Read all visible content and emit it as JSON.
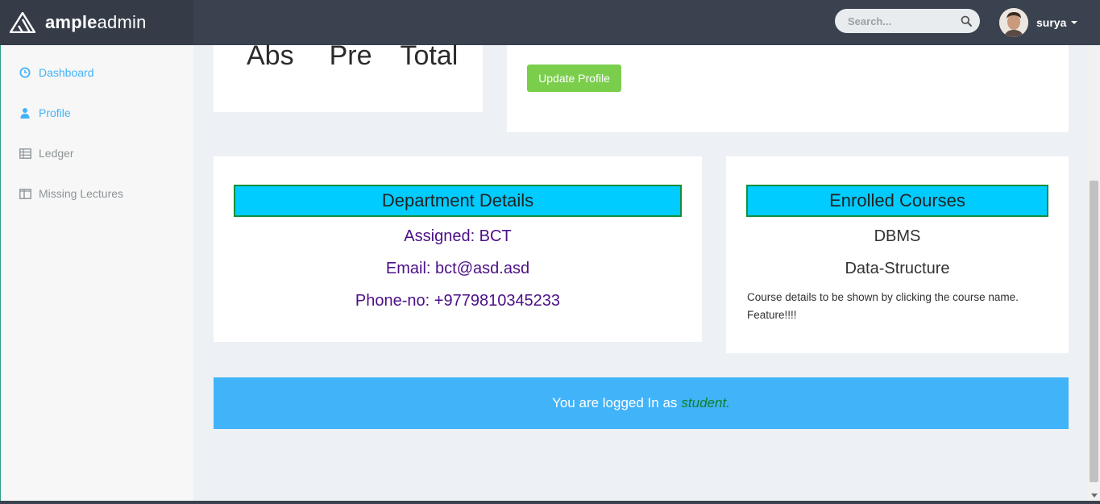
{
  "brand": {
    "bold": "ample",
    "light": "admin"
  },
  "header": {
    "search_placeholder": "Search...",
    "user_name": "surya"
  },
  "sidebar": {
    "items": [
      {
        "label": "Dashboard",
        "icon": "clock-icon",
        "active": true
      },
      {
        "label": "Profile",
        "icon": "user-icon",
        "active": true
      },
      {
        "label": "Ledger",
        "icon": "table-icon",
        "active": false
      },
      {
        "label": "Missing Lectures",
        "icon": "columns-icon",
        "active": false
      }
    ]
  },
  "attendance": {
    "labels": [
      "Abs",
      "Pre",
      "Total"
    ]
  },
  "profile": {
    "update_button": "Update Profile"
  },
  "department": {
    "title": "Department Details",
    "assigned": "Assigned: BCT",
    "email": "Email: bct@asd.asd",
    "phone": "Phone-no: +9779810345233"
  },
  "courses": {
    "title": "Enrolled Courses",
    "items": [
      "DBMS",
      "Data-Structure"
    ],
    "note": "Course details to be shown by clicking the course name. Feature!!!!"
  },
  "login_status": {
    "prefix": "You are logged In as",
    "role": "student."
  },
  "colors": {
    "topbar": "#3a4250",
    "accent_blue": "#41b3f9",
    "button_green": "#7ace4c",
    "heading_cyan": "#00ccff",
    "dept_text": "#4b0f87"
  }
}
